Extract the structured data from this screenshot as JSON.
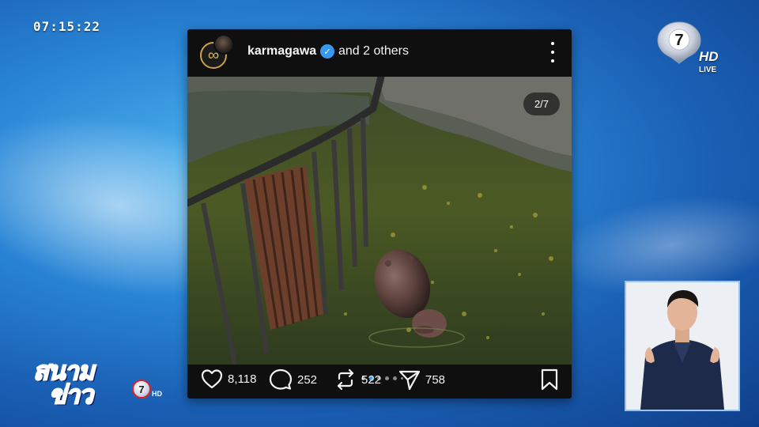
{
  "overlay": {
    "clock": "07:15:22",
    "channel_number": "7",
    "channel_hd": "HD",
    "channel_live": "LIVE"
  },
  "post": {
    "username": "karmagawa",
    "verified": true,
    "others_text": "and 2 others",
    "image_counter": "2/7",
    "carousel": {
      "count": 6,
      "active_index": 1
    },
    "actions": {
      "likes": "8,118",
      "comments": "252",
      "reposts": "522",
      "shares": "758"
    },
    "icons": [
      "heart-icon",
      "comment-icon",
      "repost-icon",
      "share-icon",
      "bookmark-icon",
      "more-icon",
      "verified-icon"
    ]
  },
  "show": {
    "title_top": "สนาม",
    "title_bottom": "ข่าว",
    "badge": "7",
    "hd": "HD"
  },
  "colors": {
    "card_bg": "#0f0f0f",
    "verified": "#3897f0",
    "carousel_active": "#3897f0",
    "background": "#2a86d6"
  }
}
